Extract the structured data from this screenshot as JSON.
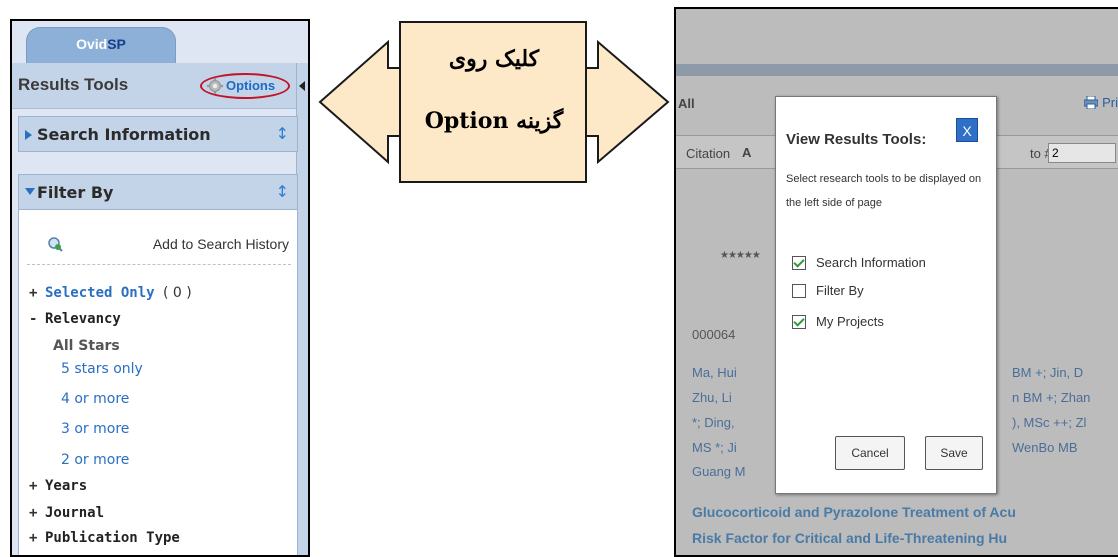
{
  "left_panel": {
    "tab_brand_prefix": "Ovid",
    "tab_brand_suffix": "SP",
    "results_tools_title": "Results Tools",
    "options_label": "Options",
    "sections": {
      "search_information": "Search Information",
      "filter_by": "Filter By"
    },
    "add_to_search_history": "Add to Search History",
    "filters": {
      "selected_only": {
        "sign": "+",
        "label": "Selected Only",
        "count": "( 0 )"
      },
      "relevancy": {
        "sign": "-",
        "label": "Relevancy"
      },
      "all_stars": "All Stars",
      "star_options": [
        "5 stars only",
        "4 or more",
        "3 or more",
        "2 or more"
      ],
      "years": {
        "sign": "+",
        "label": "Years"
      },
      "journal": {
        "sign": "+",
        "label": "Journal"
      },
      "publication_type": {
        "sign": "+",
        "label": "Publication Type"
      }
    }
  },
  "callout": {
    "line1": "کلیک روی",
    "line2": "گزینه Option"
  },
  "right_panel": {
    "all_label": "All",
    "print_label": "Pri",
    "citation_tab": "Citation",
    "tab_a": "A",
    "goto_label": "to #:",
    "goto_value": "2",
    "stars": "★★★★★",
    "record_id": "000064",
    "authors": [
      "Ma, Hui",
      "Zhu, Li",
      "*; Ding,",
      "MS *; Ji",
      "Guang M"
    ],
    "authors_right": [
      "BM +; Jin, D",
      "n BM +; Zhan",
      "), MSc ++; Zl",
      "WenBo MB"
    ],
    "title_lines": [
      "Glucocorticoid and Pyrazolone Treatment of Acu",
      "Risk Factor for Critical and Life-Threatening Hu"
    ],
    "dialog": {
      "title": "View Results Tools:",
      "close": "X",
      "description": "Select research tools to be displayed on the left side of page",
      "options": [
        {
          "label": "Search Information",
          "checked": true
        },
        {
          "label": "Filter By",
          "checked": false
        },
        {
          "label": "My Projects",
          "checked": true
        }
      ],
      "cancel": "Cancel",
      "save": "Save"
    }
  },
  "colors": {
    "panel_bg": "#dde6f2",
    "header_bg": "#c4d4e8",
    "link_blue": "#2a6fc4",
    "highlight_red": "#c0142a",
    "callout_fill": "#fde9c8",
    "dialog_close_blue": "#2e6fc7"
  }
}
